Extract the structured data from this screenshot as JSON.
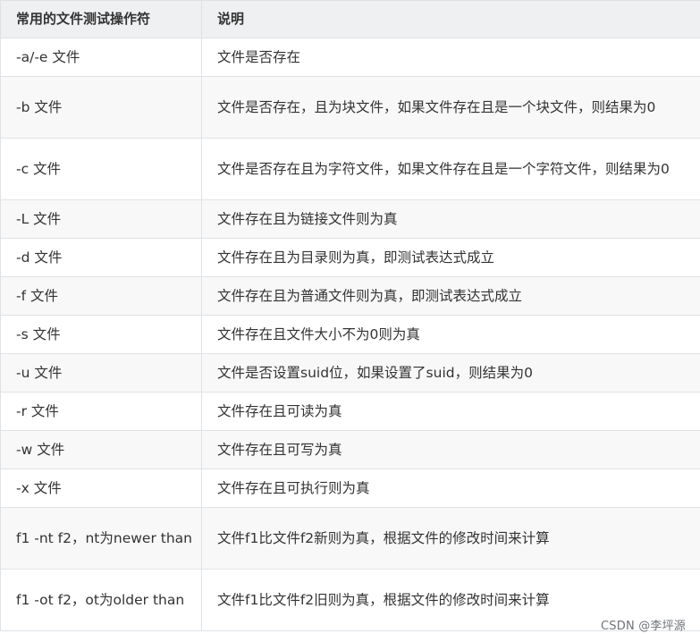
{
  "table": {
    "headers": [
      "常用的文件测试操作符",
      "说明"
    ],
    "rows": [
      {
        "op": "-a/-e 文件",
        "desc": "文件是否存在"
      },
      {
        "op": "-b 文件",
        "desc": "文件是否存在，且为块文件，如果文件存在且是一个块文件，则结果为0"
      },
      {
        "op": "-c 文件",
        "desc": "文件是否存在且为字符文件，如果文件存在且是一个字符文件，则结果为0"
      },
      {
        "op": "-L 文件",
        "desc": "文件存在且为链接文件则为真"
      },
      {
        "op": "-d 文件",
        "desc": "文件存在且为目录则为真，即测试表达式成立"
      },
      {
        "op": "-f 文件",
        "desc": "文件存在且为普通文件则为真，即测试表达式成立"
      },
      {
        "op": "-s 文件",
        "desc": "文件存在且文件大小不为0则为真"
      },
      {
        "op": "-u 文件",
        "desc": "文件是否设置suid位，如果设置了suid，则结果为0"
      },
      {
        "op": "-r 文件",
        "desc": "文件存在且可读为真"
      },
      {
        "op": "-w 文件",
        "desc": "文件存在且可写为真"
      },
      {
        "op": "-x 文件",
        "desc": "文件存在且可执行则为真"
      },
      {
        "op": "f1 -nt f2，nt为newer than",
        "desc": "文件f1比文件f2新则为真，根据文件的修改时间来计算"
      },
      {
        "op": "f1 -ot f2，ot为older than",
        "desc": "文件f1比文件f2旧则为真，根据文件的修改时间来计算"
      }
    ]
  },
  "watermark": "CSDN @李坪源"
}
